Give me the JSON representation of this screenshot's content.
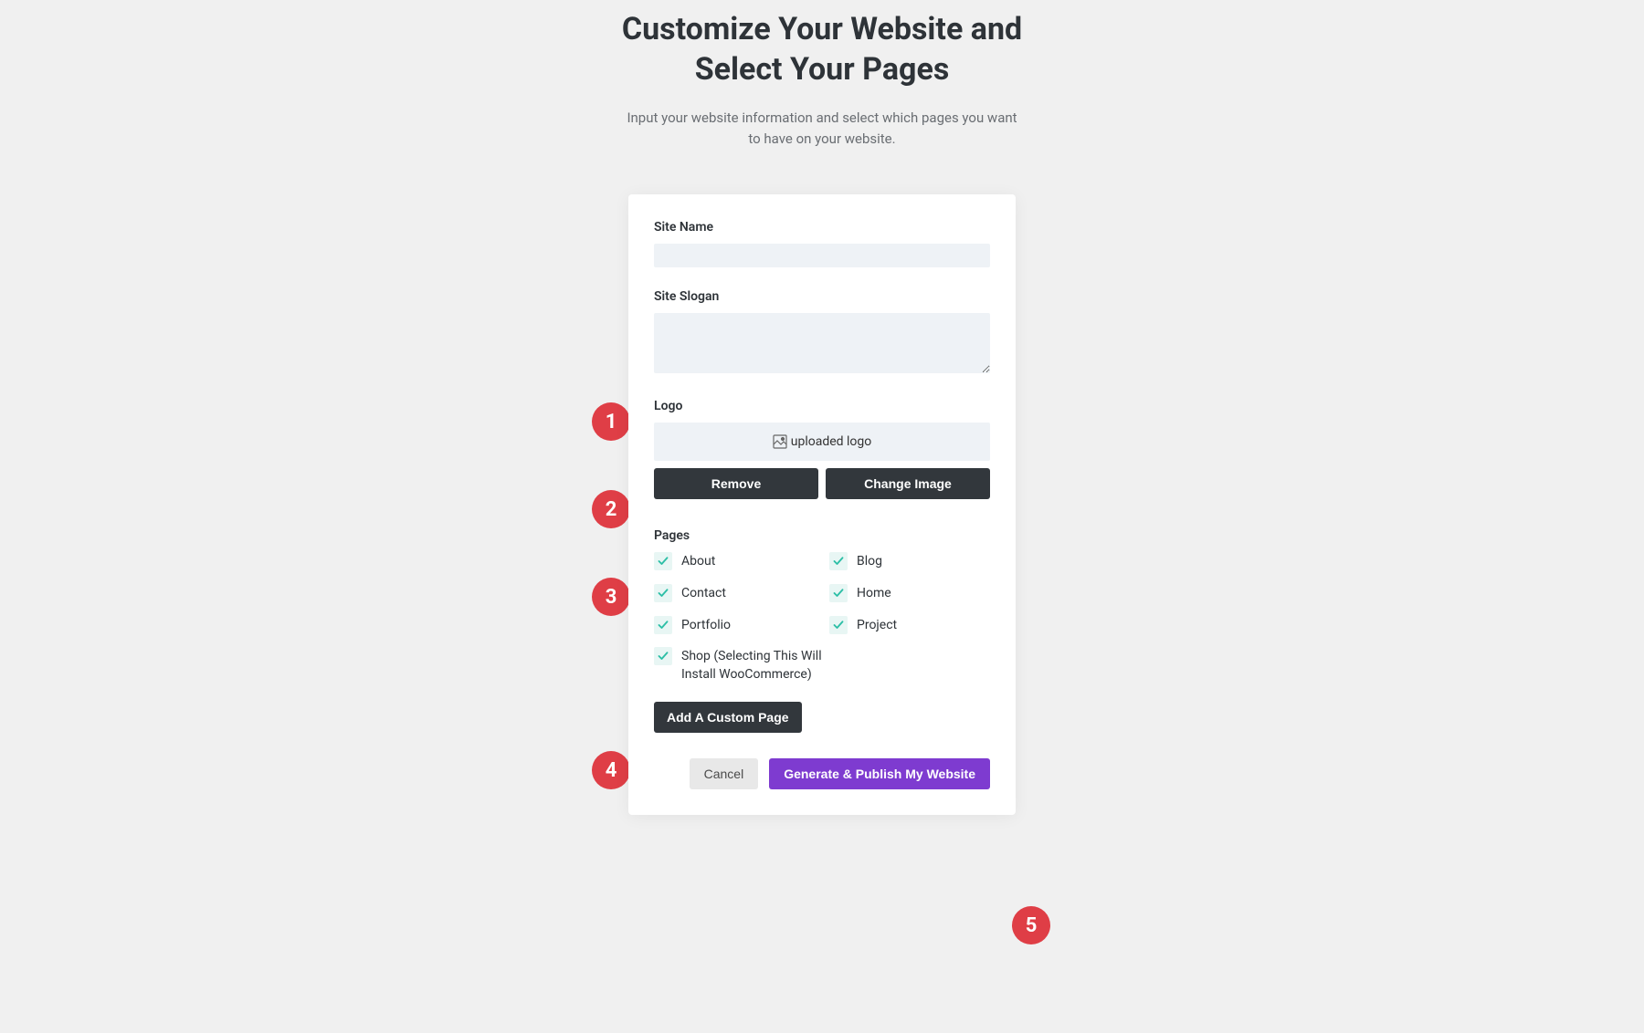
{
  "heading": "Customize Your Website and Select Your Pages",
  "subheading": "Input your website information and select which pages you want to have on your website.",
  "form": {
    "siteName": {
      "label": "Site Name",
      "value": ""
    },
    "siteSlogan": {
      "label": "Site Slogan",
      "value": ""
    },
    "logo": {
      "label": "Logo",
      "altText": "uploaded logo",
      "removeButton": "Remove",
      "changeButton": "Change Image"
    },
    "pages": {
      "label": "Pages",
      "items": [
        {
          "label": "About",
          "checked": true
        },
        {
          "label": "Blog",
          "checked": true
        },
        {
          "label": "Contact",
          "checked": true
        },
        {
          "label": "Home",
          "checked": true
        },
        {
          "label": "Portfolio",
          "checked": true
        },
        {
          "label": "Project",
          "checked": true
        },
        {
          "label": "Shop (Selecting This Will Install WooCommerce)",
          "checked": true,
          "fullWidth": true
        }
      ],
      "addCustomButton": "Add A Custom Page"
    },
    "cancelButton": "Cancel",
    "generateButton": "Generate & Publish My Website"
  },
  "badges": {
    "b1": "1",
    "b2": "2",
    "b3": "3",
    "b4": "4",
    "b5": "5"
  },
  "colors": {
    "badge": "#df3e46",
    "primary": "#7e3bd0",
    "dark": "#32373c",
    "checkmark": "#2cbfa6"
  }
}
